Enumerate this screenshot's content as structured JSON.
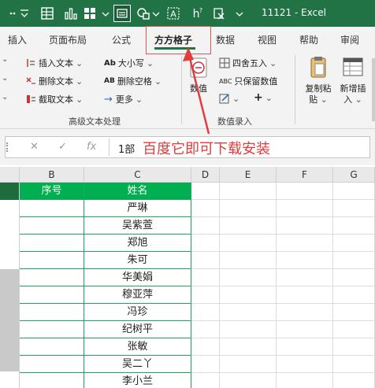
{
  "titlebar": {
    "doc_title": "11121  -  Excel",
    "qat_icons": [
      "more-dots-icon",
      "qat-dropdown-icon",
      "form-icon",
      "bar-chart-icon",
      "table-icon",
      "screenshot-icon",
      "shapes-icon",
      "textbox-icon",
      "question-icon",
      "clear-icon"
    ]
  },
  "tabs": [
    {
      "label": "插入"
    },
    {
      "label": "页面布局"
    },
    {
      "label": "公式"
    },
    {
      "label": "方方格子"
    },
    {
      "label": "数据"
    },
    {
      "label": "视图"
    },
    {
      "label": "帮助"
    },
    {
      "label": "审阅"
    }
  ],
  "ribbon": {
    "text_group": {
      "insert_text": "插入文本",
      "delete_text": "删除文本",
      "extract_text": "截取文本",
      "case": "大小写",
      "delete_spaces": "删除空格",
      "more": "更多",
      "label": "高级文本处理",
      "ab_glyph": "Ab",
      "ab_caps_glyph": "AB"
    },
    "number_group": {
      "round": "四舍五入",
      "keep_value": "只保留数值",
      "label": "数值录入",
      "value_btn": "数值",
      "abc_glyph": "ABC"
    },
    "copy_paste": {
      "line1": "复制粘",
      "line2": "贴"
    },
    "new_add": {
      "line1": "新增插",
      "line2": "入"
    },
    "plus": "+"
  },
  "formula_bar": {
    "cancel": "✕",
    "confirm": "✓",
    "fx": "fx",
    "value": "1部",
    "annotation": "百度它即可下载安装"
  },
  "grid": {
    "columns": [
      "B",
      "C",
      "D",
      "E",
      "F",
      "G"
    ],
    "header_row": {
      "b": "序号",
      "c": "姓名"
    },
    "names": [
      "严琳",
      "吴紫萱",
      "郑旭",
      "朱可",
      "华美娟",
      "穆亚萍",
      "冯珍",
      "纪树平",
      "张敏",
      "吴二丫",
      "李小兰"
    ]
  },
  "colors": {
    "excel_green": "#217346",
    "header_green": "#00b050",
    "annotation_red": "#e23c3c"
  }
}
